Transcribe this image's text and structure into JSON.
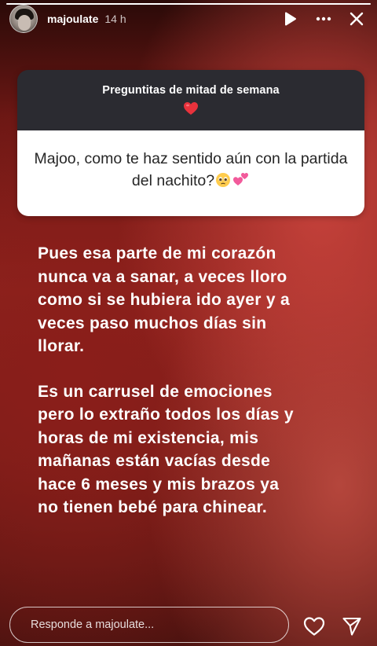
{
  "story": {
    "progress": 1.0,
    "user": {
      "username": "majoulate",
      "time_ago": "14 h"
    },
    "header_icons": [
      "play-icon",
      "more-icon",
      "close-icon"
    ]
  },
  "question_sticker": {
    "title": "Preguntitas de mitad de semana",
    "title_emoji": "red-heart-icon",
    "question": "Majoo, como te haz sentido aún con la partida del nachito?",
    "question_emojis": [
      "pleading-face-icon",
      "two-hearts-icon"
    ]
  },
  "answer": {
    "paragraph_1": "Pues esa parte de mi corazón nunca va a sanar, a veces lloro como si se hubiera ido ayer y a veces paso muchos días sin llorar.",
    "paragraph_2": "Es un carrusel de emociones pero lo extraño todos los días y horas de mi existencia, mis mañanas están vacías desde hace 6 meses y mis brazos ya no tienen bebé para chinear."
  },
  "footer": {
    "reply_placeholder": "Responde a majoulate...",
    "icons": [
      "heart-outline-icon",
      "send-icon"
    ]
  },
  "colors": {
    "question_header_bg": "#2b2b31",
    "question_body_bg": "#ffffff",
    "text_white": "#ffffff"
  }
}
